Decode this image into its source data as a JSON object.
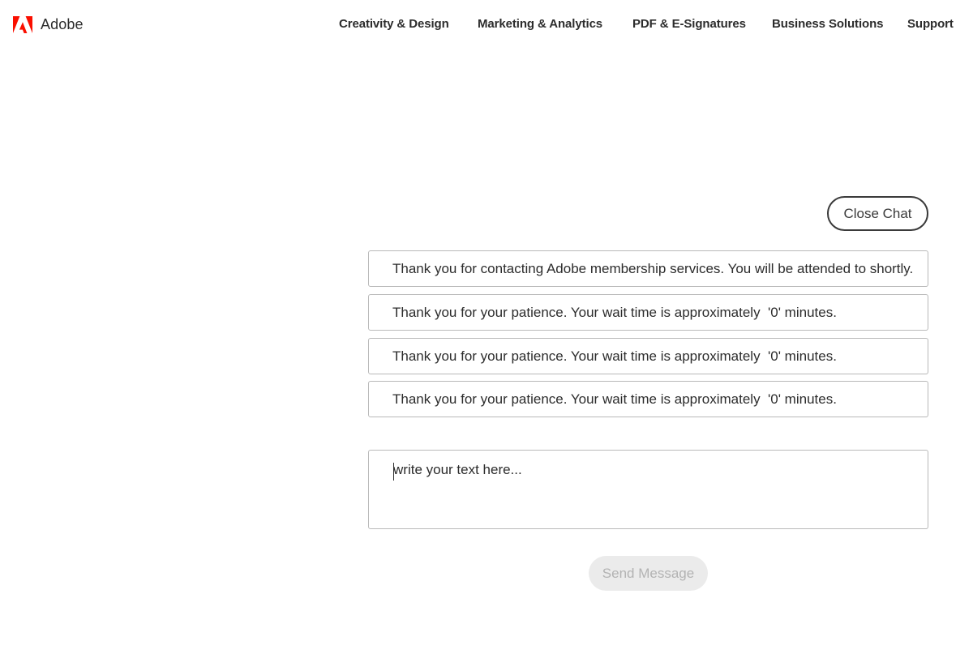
{
  "brand": {
    "name": "Adobe",
    "color": "#fa0f00"
  },
  "nav": {
    "items": [
      {
        "label": "Creativity & Design"
      },
      {
        "label": "Marketing & Analytics"
      },
      {
        "label": "PDF & E-Signatures"
      },
      {
        "label": "Business Solutions"
      },
      {
        "label": "Support"
      }
    ]
  },
  "chat": {
    "close_label": "Close Chat",
    "messages": [
      {
        "text": "Thank you for contacting Adobe membership services. You will be attended to shortly."
      },
      {
        "text": "Thank you for your patience. Your wait time is approximately  '0' minutes."
      },
      {
        "text": "Thank you for your patience. Your wait time is approximately  '0' minutes."
      },
      {
        "text": "Thank you for your patience. Your wait time is approximately  '0' minutes."
      }
    ],
    "input": {
      "placeholder": "write your text here...",
      "value": ""
    },
    "send_label": "Send Message"
  }
}
